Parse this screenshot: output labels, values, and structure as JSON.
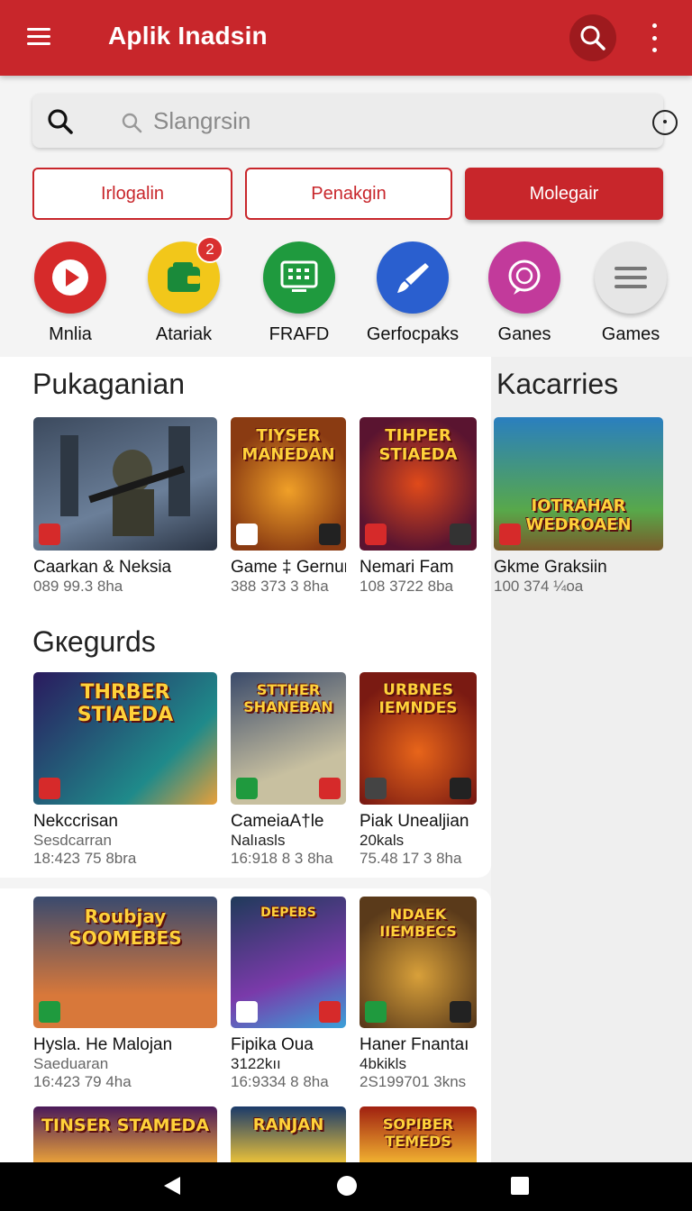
{
  "header": {
    "title": "Aplik Inadsin"
  },
  "search": {
    "placeholder": "Slangrsin"
  },
  "chips": [
    "Irlogalin",
    "Penakgin",
    "Molegair"
  ],
  "categories": [
    {
      "label": "Mnlia",
      "icon": "play-icon",
      "color": "#d62a2a"
    },
    {
      "label": "Atariak",
      "icon": "wallet-icon",
      "color": "#f2c71a",
      "badge": "2"
    },
    {
      "label": "FRAFD",
      "icon": "monitor-grid-icon",
      "color": "#1f9a3e"
    },
    {
      "label": "Gerfocpaks",
      "icon": "brush-icon",
      "color": "#2a5fcf"
    },
    {
      "label": "Ganes",
      "icon": "chat-bubble-icon",
      "color": "#c23a9b"
    },
    {
      "label": "Games",
      "icon": "menu-lines-icon",
      "color": "#e6e6e6"
    }
  ],
  "sections": {
    "left_top": "Pukaganian",
    "right_top": "Kacarries",
    "left_mid": "Gкegurds"
  },
  "cards": {
    "row1": [
      {
        "name": "Caarkan & Neksia",
        "sub": "089  99.3 8ha",
        "art": "",
        "colors": [
          "#3c4a5e",
          "#6b7f99"
        ]
      },
      {
        "name": "Game ‡ Gernur",
        "sub": "388 373 3 8ha",
        "art": "TIYSER MANEDAN",
        "colors": [
          "#8a3b12",
          "#f0a028"
        ]
      },
      {
        "name": "Nemari Fam",
        "sub": "108 3722 8ba",
        "art": "TIHPER STIAEDA",
        "colors": [
          "#5a1430",
          "#e04a1a"
        ]
      }
    ],
    "right1": {
      "name": "Gkme Graksiin",
      "sub": "100 374 ¼oa",
      "art": "IOTRAHAR WEDROAEN",
      "colors": [
        "#2a7fbf",
        "#58a84a"
      ]
    },
    "row2": [
      {
        "name": "Nekccrisan",
        "sub2": "Sesdcarran",
        "sub": "18:423  75 8bra",
        "art": "THRBER STIAEDA",
        "colors": [
          "#2a1a5e",
          "#1f8a8a"
        ]
      },
      {
        "name": "CameiaA†le",
        "sub2": "Nalıasls",
        "sub": "16:918 8 3 8ha",
        "art": "STTHER SHANEBAN",
        "colors": [
          "#3a4a6a",
          "#c8c0a0"
        ]
      },
      {
        "name": "Piak Unealjian",
        "sub2": "20kals",
        "sub": "75.48 17 3 8ha",
        "art": "URBNES IEMNDES",
        "colors": [
          "#7a1a12",
          "#e8651a"
        ]
      }
    ],
    "row3": [
      {
        "name": "Hysla. He Malojan",
        "sub2": "Saeduaran",
        "sub": "16:423 79 4ha",
        "art": "Roubjay SOOMEBES",
        "colors": [
          "#3a4a6e",
          "#d8783a"
        ]
      },
      {
        "name": "Fipika Oua",
        "sub2": "3122kıı",
        "sub": "16:9334 8 8ha",
        "art": "DEPEBS",
        "colors": [
          "#1f3a5a",
          "#7a3aaa"
        ]
      },
      {
        "name": "Haner Fnantaı",
        "sub2": "4bkikls",
        "sub": "2S199701 3kns",
        "art": "NDAEK IIEMBECS",
        "colors": [
          "#5a3a1a",
          "#d8a03a"
        ]
      }
    ],
    "row4": [
      {
        "art": "TINSER STAMEDA",
        "colors": [
          "#4a1a5a",
          "#e8a03a"
        ]
      },
      {
        "art": "RANJAN",
        "colors": [
          "#1a3a6a",
          "#e8c03a"
        ]
      },
      {
        "art": "SOPIBER TEMEDS",
        "colors": [
          "#a02010",
          "#f0b030"
        ]
      }
    ]
  }
}
